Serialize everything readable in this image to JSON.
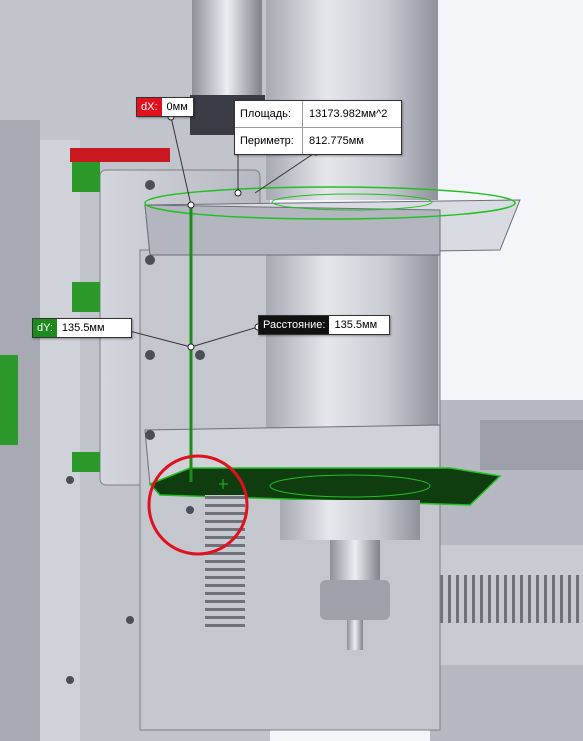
{
  "scene": {
    "model": "cnc-router-z-axis-spindle-assembly",
    "colors": {
      "background": "#f4f5f8",
      "metal_light": "#d9dbe2",
      "metal_mid": "#a9abb6",
      "metal_dark": "#5a5c66",
      "selection_green": "#22c022",
      "marker_red": "#e0111e",
      "rail_red": "#c9181f",
      "rail_green": "#2b9a2b"
    }
  },
  "measure": {
    "dx": {
      "key": "dX:",
      "value": "0мм"
    },
    "dy": {
      "key": "dY:",
      "value": "135.5мм"
    },
    "distance": {
      "key": "Расстояние:",
      "value": "135.5мм"
    }
  },
  "properties": {
    "area_label": "Площадь:",
    "area_value": "13173.982мм^2",
    "perimeter_label": "Периметр:",
    "perimeter_value": "812.775мм"
  },
  "icons": {
    "cursor": "crosshair-plus-icon",
    "highlight": "red-circle-marker"
  }
}
